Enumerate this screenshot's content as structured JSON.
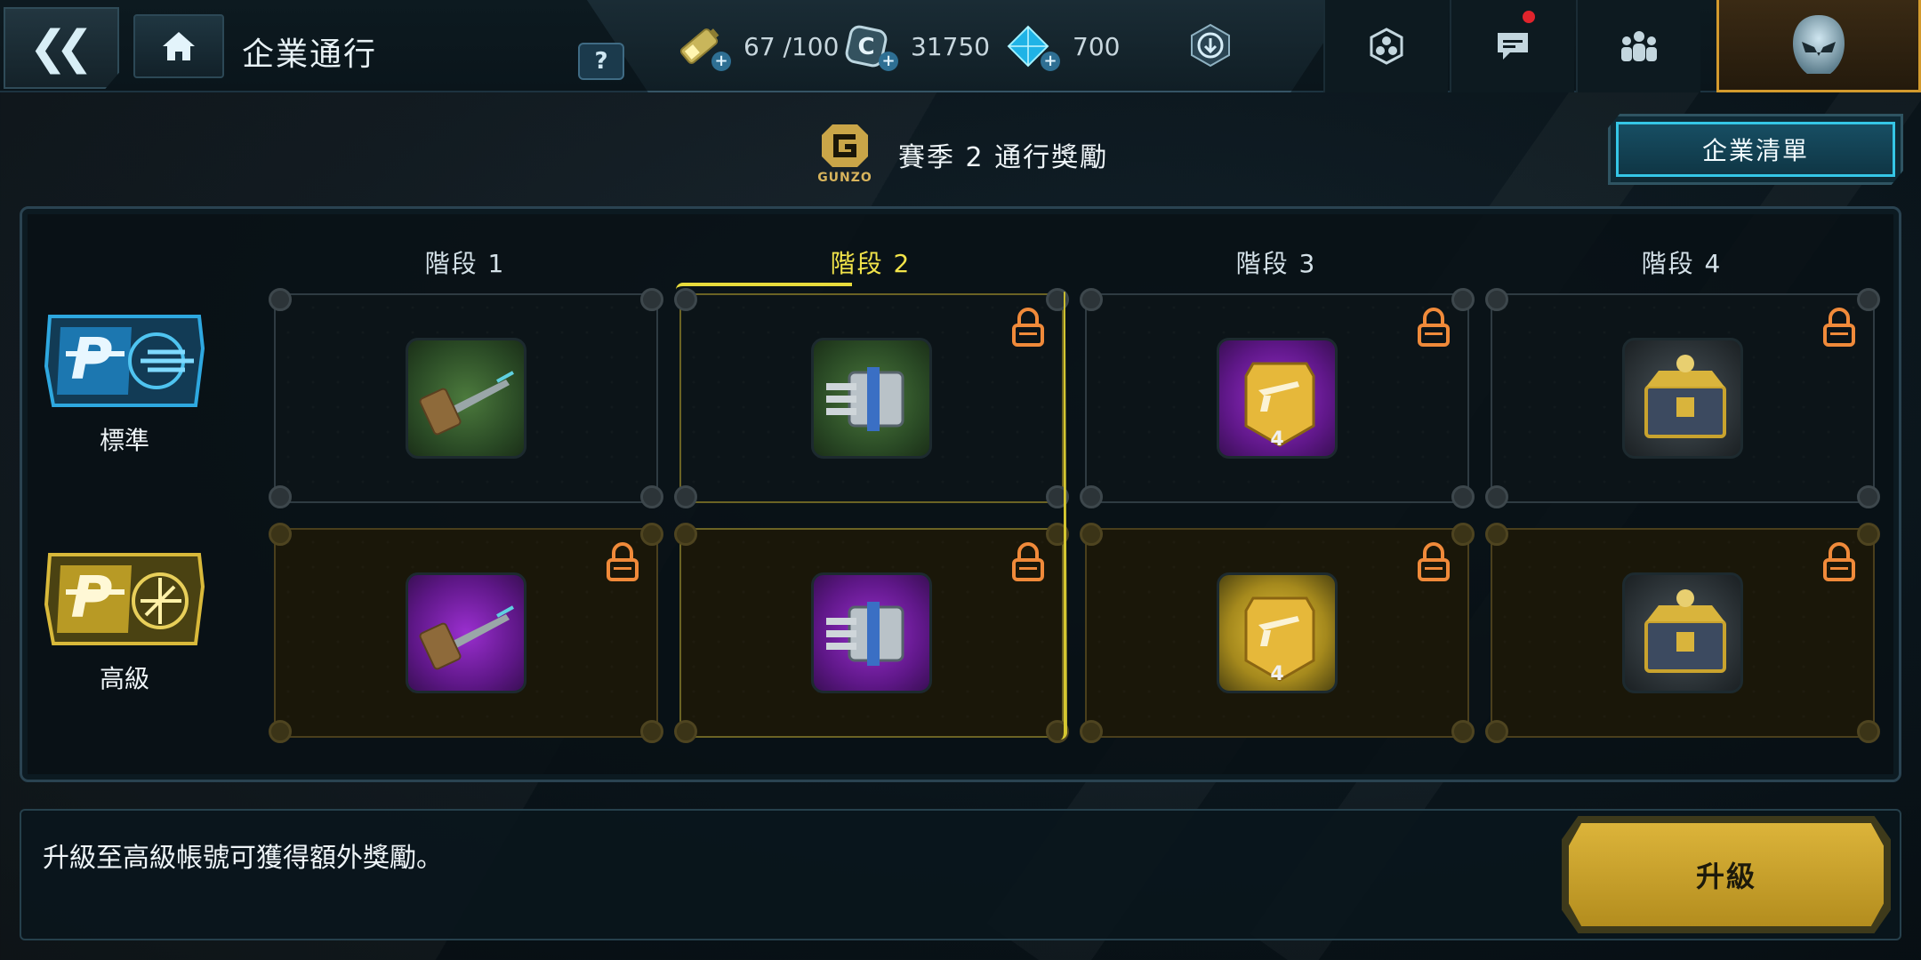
{
  "topbar": {
    "back_glyph": "❮❮",
    "title": "企業通行",
    "help_glyph": "?"
  },
  "currencies": [
    {
      "name": "energy",
      "icon": "battery-icon",
      "value": "67 /100"
    },
    {
      "name": "credits",
      "icon": "coin-icon",
      "value": "31750"
    },
    {
      "name": "crystals",
      "icon": "crystal-icon",
      "value": "700"
    }
  ],
  "season": {
    "logo_word": "GUNZO",
    "title": "賽季 2 通行獎勵"
  },
  "list_button": "企業清單",
  "tiers": {
    "standard": "標準",
    "premium": "高級"
  },
  "stages": [
    {
      "label": "階段 1",
      "active": false
    },
    {
      "label": "階段 2",
      "active": true
    },
    {
      "label": "階段 3",
      "active": false
    },
    {
      "label": "階段 4",
      "active": false
    }
  ],
  "rewards": {
    "standard": [
      {
        "item": "hammer",
        "rarity": "green",
        "locked": false,
        "count": ""
      },
      {
        "item": "gatling",
        "rarity": "green",
        "locked": true,
        "count": ""
      },
      {
        "item": "weapon-crate",
        "rarity": "purple",
        "locked": true,
        "count": "4"
      },
      {
        "item": "supply-chest",
        "rarity": "grey",
        "locked": true,
        "count": ""
      }
    ],
    "premium": [
      {
        "item": "hammer",
        "rarity": "purple",
        "locked": true,
        "count": ""
      },
      {
        "item": "gatling",
        "rarity": "purple",
        "locked": true,
        "count": ""
      },
      {
        "item": "weapon-crate",
        "rarity": "gold",
        "locked": true,
        "count": "4"
      },
      {
        "item": "supply-chest",
        "rarity": "grey",
        "locked": true,
        "count": ""
      }
    ]
  },
  "footer": {
    "message": "升級至高級帳號可獲得額外獎勵。",
    "upgrade_label": "升級"
  },
  "colors": {
    "accent_cyan": "#35c6e6",
    "active_stage": "#f2e44a",
    "lock_orange": "#f08a3a",
    "upgrade_gold": "#dcb43a",
    "notification": "#e0242c"
  }
}
